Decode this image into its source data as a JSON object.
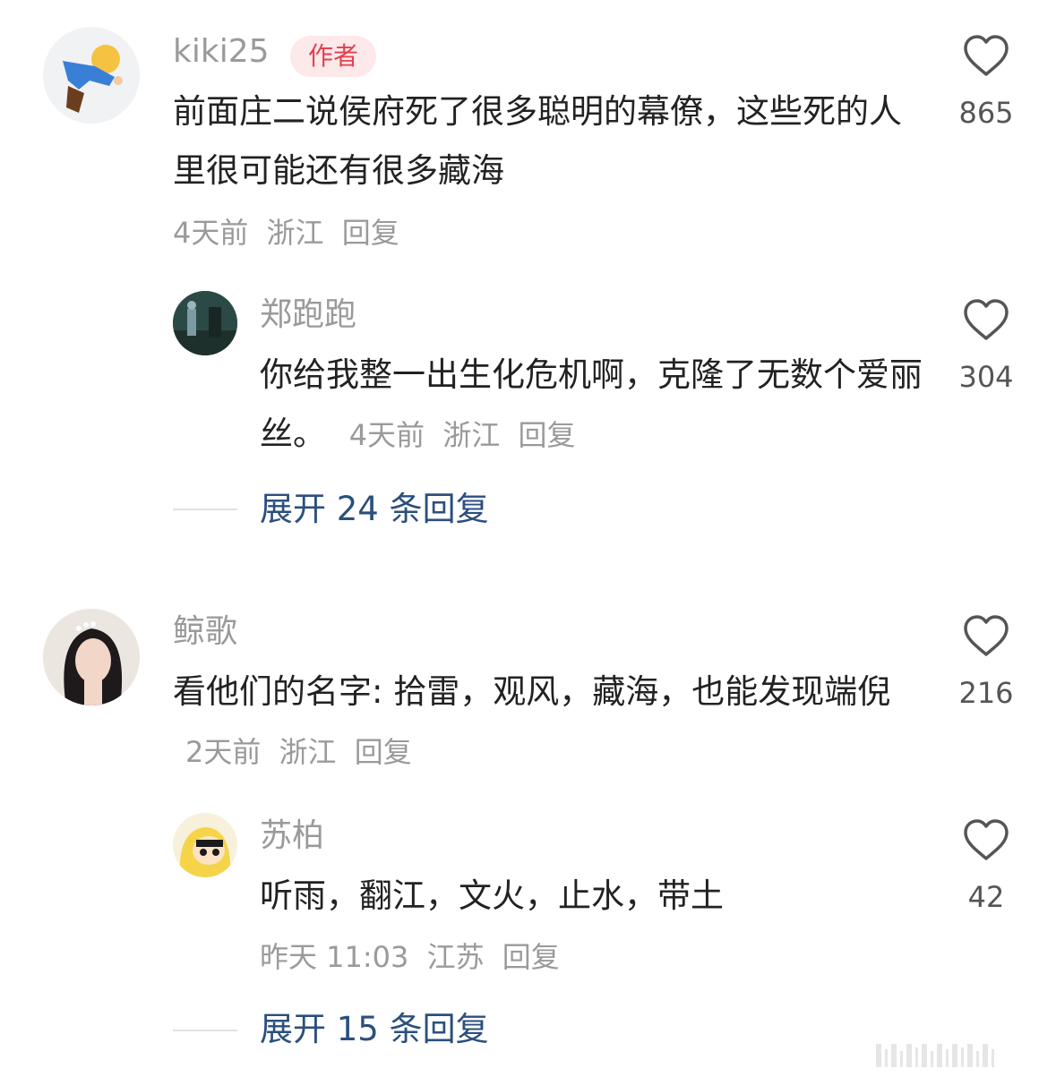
{
  "comments": [
    {
      "author": "kiki25",
      "badge": "作者",
      "text": "前面庄二说侯府死了很多聪明的幕僚，这些死的人里很可能还有很多藏海",
      "time": "4天前",
      "location": "浙江",
      "reply_label": "回复",
      "likes": "865",
      "replies": [
        {
          "author": "郑跑跑",
          "text": "你给我整一出生化危机啊，克隆了无数个爱丽丝。",
          "time": "4天前",
          "location": "浙江",
          "reply_label": "回复",
          "likes": "304"
        }
      ],
      "expand_label": "展开 24 条回复"
    },
    {
      "author": "鲸歌",
      "text": "看他们的名字: 拾雷，观风，藏海，也能发现端倪",
      "time": "2天前",
      "location": "浙江",
      "reply_label": "回复",
      "likes": "216",
      "replies": [
        {
          "author": "苏柏",
          "text": "听雨，翻江，文火，止水，带土",
          "time": "昨天 11:03",
          "location": "江苏",
          "reply_label": "回复",
          "likes": "42"
        }
      ],
      "expand_label": "展开 15 条回复"
    }
  ],
  "colors": {
    "name": "#9a9a9a",
    "text": "#222222",
    "link": "#2b4f7d",
    "badge_bg": "#fde8ea",
    "badge_text": "#e0424f"
  },
  "icons": {
    "like": "heart-outline-icon"
  },
  "watermark": "||||||||||||||||"
}
